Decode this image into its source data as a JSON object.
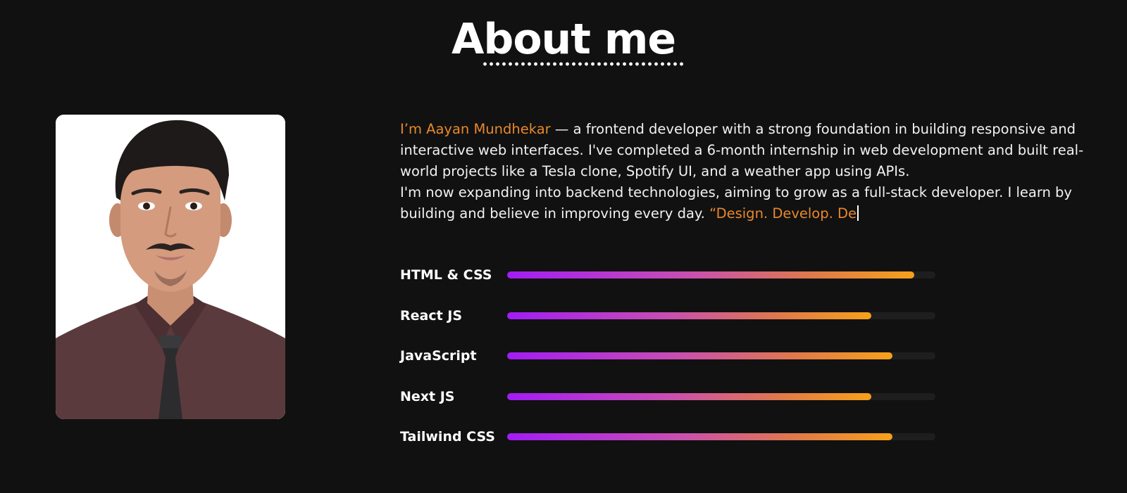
{
  "section": {
    "title": "About me"
  },
  "profile": {
    "photo_alt": "Portrait photo"
  },
  "bio": {
    "name_intro": "I’m Aayan Mundhekar",
    "line1_rest": " — a frontend developer with a strong foundation in building responsive and interactive web interfaces. I've completed a 6-month internship in web development and built real-world projects like a Tesla clone, Spotify UI, and a weather app using APIs.",
    "line2": "I'm now expanding into backend technologies, aiming to grow as a full-stack developer. I learn by building and believe in improving every day. ",
    "typing_quote": "“Design. Develop. De"
  },
  "skills": [
    {
      "name": "HTML & CSS",
      "level": 0.95
    },
    {
      "name": "React JS",
      "level": 0.85
    },
    {
      "name": "JavaScript",
      "level": 0.9
    },
    {
      "name": "Next JS",
      "level": 0.85
    },
    {
      "name": "Tailwind CSS",
      "level": 0.9
    }
  ],
  "colors": {
    "background": "#111111",
    "accent": "#e8882c",
    "bar_gradient_start": "#a21cf5",
    "bar_gradient_end": "#f6a11a",
    "bar_track": "#1e1e1e"
  }
}
